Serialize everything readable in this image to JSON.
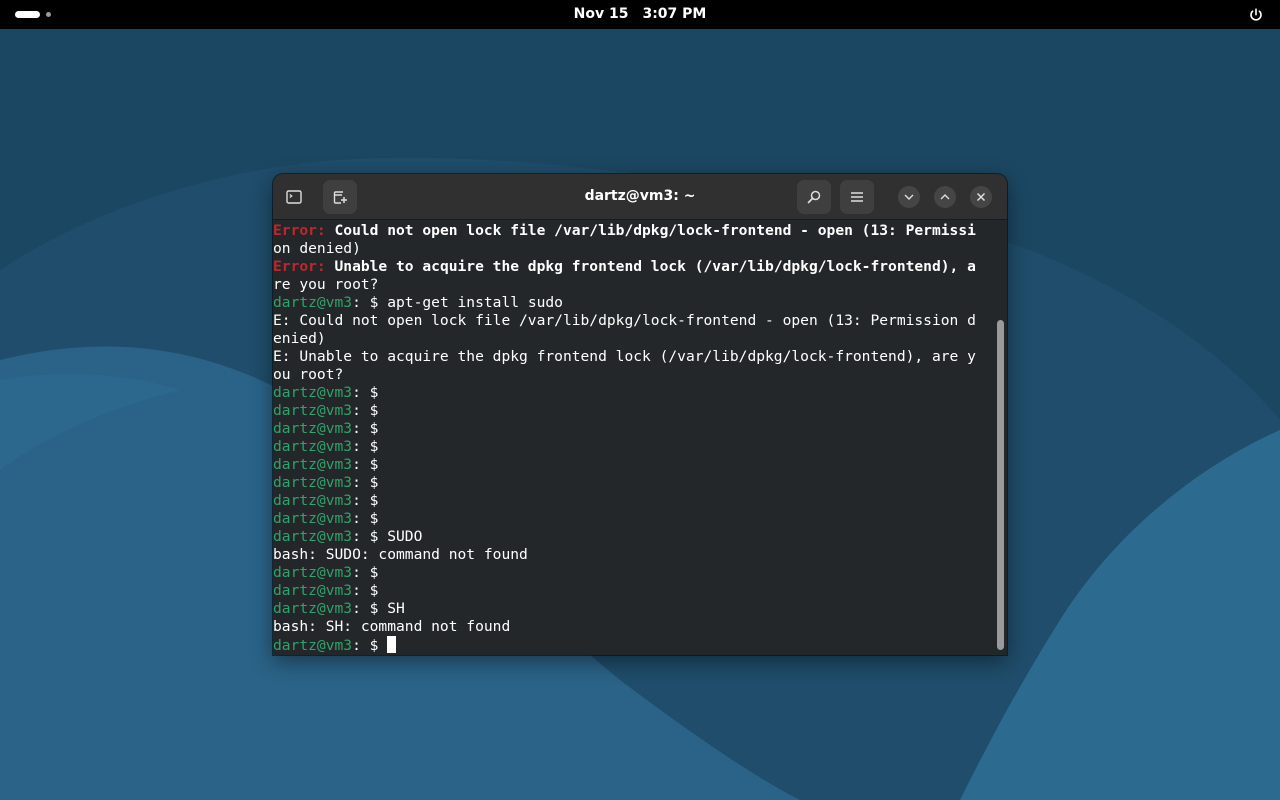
{
  "topbar": {
    "date": "Nov 15",
    "time": "3:07 PM",
    "activities_icon": "workspace-indicator-icon",
    "power_icon": "power-icon"
  },
  "window": {
    "title": "dartz@vm3: ~",
    "buttons": {
      "terminal_icon": "terminal-icon",
      "new_tab_icon": "new-tab-icon",
      "search_icon": "search-icon",
      "menu_icon": "hamburger-menu-icon",
      "minimize_icon": "minimize-icon",
      "maximize_icon": "maximize-icon",
      "close_icon": "close-icon"
    }
  },
  "terminal": {
    "lines": [
      {
        "label": "Error:",
        "text": " Could not open lock file /var/lib/dpkg/lock-frontend - open (13: Permissi"
      },
      {
        "text": "on denied)"
      },
      {
        "label": "Error:",
        "text": " Unable to acquire the dpkg frontend lock (/var/lib/dpkg/lock-frontend), a"
      },
      {
        "text": "re you root?"
      },
      {
        "prompt": "dartz@vm3",
        "sep": ": $ ",
        "cmd": "apt-get install sudo"
      },
      {
        "text": "E: Could not open lock file /var/lib/dpkg/lock-frontend - open (13: Permission d"
      },
      {
        "text": "enied)"
      },
      {
        "text": "E: Unable to acquire the dpkg frontend lock (/var/lib/dpkg/lock-frontend), are y"
      },
      {
        "text": "ou root?"
      },
      {
        "prompt": "dartz@vm3",
        "sep": ": $ ",
        "cmd": ""
      },
      {
        "prompt": "dartz@vm3",
        "sep": ": $ ",
        "cmd": ""
      },
      {
        "prompt": "dartz@vm3",
        "sep": ": $ ",
        "cmd": ""
      },
      {
        "prompt": "dartz@vm3",
        "sep": ": $ ",
        "cmd": ""
      },
      {
        "prompt": "dartz@vm3",
        "sep": ": $ ",
        "cmd": ""
      },
      {
        "prompt": "dartz@vm3",
        "sep": ": $ ",
        "cmd": ""
      },
      {
        "prompt": "dartz@vm3",
        "sep": ": $ ",
        "cmd": ""
      },
      {
        "prompt": "dartz@vm3",
        "sep": ": $ ",
        "cmd": ""
      },
      {
        "prompt": "dartz@vm3",
        "sep": ": $ ",
        "cmd": "SUDO"
      },
      {
        "text": "bash: SUDO: command not found"
      },
      {
        "prompt": "dartz@vm3",
        "sep": ": $ ",
        "cmd": ""
      },
      {
        "prompt": "dartz@vm3",
        "sep": ": $ ",
        "cmd": ""
      },
      {
        "prompt": "dartz@vm3",
        "sep": ": $ ",
        "cmd": "SH"
      },
      {
        "text": "bash: SH: command not found"
      },
      {
        "prompt": "dartz@vm3",
        "sep": ": $ ",
        "cmd": "",
        "cursor": true
      }
    ]
  },
  "colors": {
    "error_label": "#c0262e",
    "prompt": "#2ea36a",
    "terminal_bg": "#232729",
    "headerbar_bg": "#303030",
    "desktop_bg": "#1f4d6b"
  }
}
